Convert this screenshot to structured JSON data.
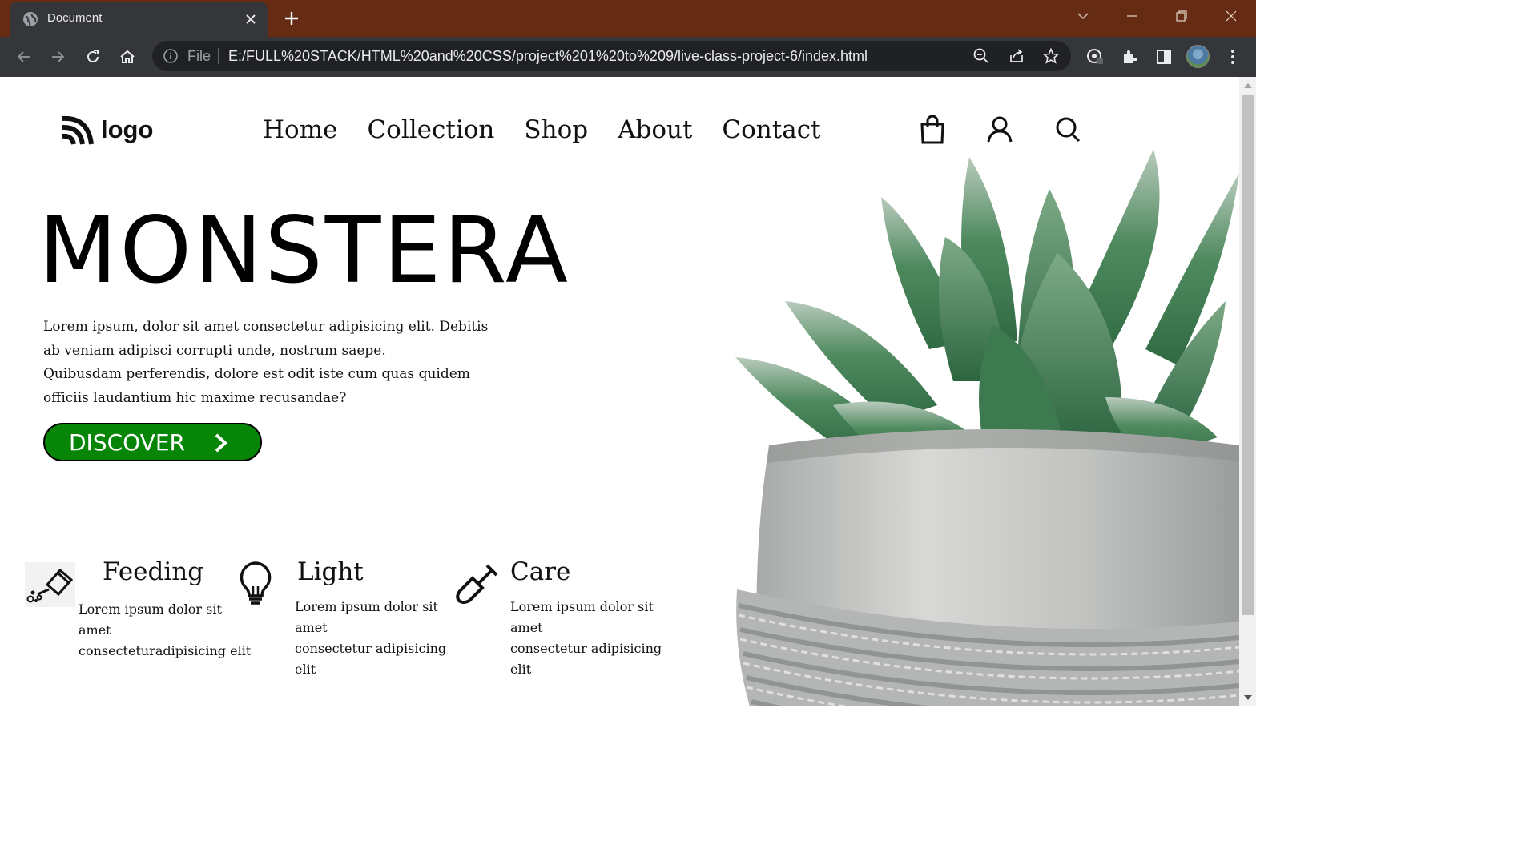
{
  "browser": {
    "tab_title": "Document",
    "address_prefix": "File",
    "url": "E:/FULL%20STACK/HTML%20and%20CSS/project%201%20to%209/live-class-project-6/index.html",
    "tabbar_color": "#652b13"
  },
  "page": {
    "logo_text": "logo",
    "nav": [
      "Home",
      "Collection",
      "Shop",
      "About",
      "Contact"
    ],
    "hero": {
      "title": "MONSTERA",
      "paragraph_1": "Lorem ipsum, dolor sit amet consectetur adipisicing elit. Debitis ab veniam adipisci corrupti unde, nostrum saepe.",
      "paragraph_2": "Quibusdam perferendis, dolore est odit iste cum quas quidem officiis laudantium hic maxime recusandae?",
      "cta_label": "DISCOVER",
      "cta_color": "#068506"
    },
    "features": [
      {
        "title": "Feeding",
        "text_line_1": "Lorem ipsum dolor sit amet",
        "text_line_2": "consecteturadipisicing elit",
        "icon": "watering-can-icon"
      },
      {
        "title": "Light",
        "text_line_1": "Lorem ipsum dolor sit amet",
        "text_line_2": "consectetur adipisicing elit",
        "icon": "light-bulb-icon"
      },
      {
        "title": "Care",
        "text_line_1": "Lorem ipsum dolor sit amet",
        "text_line_2": "consectetur adipisicing elit",
        "icon": "shovel-icon"
      }
    ]
  }
}
